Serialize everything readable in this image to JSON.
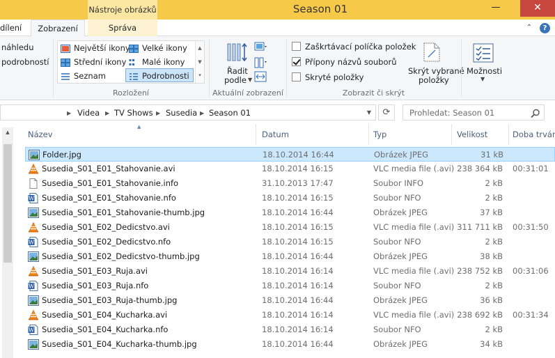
{
  "titlebar": {
    "context_tab": "Nástroje obrázků",
    "title": "Season 01",
    "minimize": "—",
    "maximize": "❐",
    "close": "✕"
  },
  "tabs": {
    "share": "dílení",
    "view": "Zobrazení",
    "manage": "Správa"
  },
  "ribbon": {
    "pane_items": [
      "náhledu",
      "podrobností"
    ],
    "layout": {
      "items": [
        "Největší ikony",
        "Velké ikony",
        "Střední ikony",
        "Malé ikony",
        "Seznam",
        "Podrobnosti"
      ],
      "selected": "Podrobnosti",
      "group_label": "Rozložení"
    },
    "current_view": {
      "sort_label_1": "Řadit",
      "sort_label_2": "podle",
      "group_label": "Aktuální zobrazení"
    },
    "show_hide": {
      "checkboxes": [
        {
          "label": "Zaškrtávací políčka položek",
          "checked": false
        },
        {
          "label": "Přípony názvů souborů",
          "checked": true
        },
        {
          "label": "Skryté položky",
          "checked": false
        }
      ],
      "hide_selected_1": "Skrýt vybrané",
      "hide_selected_2": "položky",
      "group_label": "Zobrazit či skrýt"
    },
    "options_label": "Možnosti"
  },
  "address": {
    "breadcrumbs": [
      "Videa",
      "TV Shows",
      "Susedia",
      "Season 01"
    ],
    "search_placeholder": "Prohledat: Season 01"
  },
  "columns": {
    "name": "Název",
    "date": "Datum",
    "type": "Typ",
    "size": "Velikost",
    "duration": "Doba trván"
  },
  "files": [
    {
      "name": "Folder.jpg",
      "date": "18.10.2014 16:44",
      "type": "Obrázek JPEG",
      "size": "31 kB",
      "duration": "",
      "icon": "jpg",
      "selected": true
    },
    {
      "name": "Susedia_S01_E01_Stahovanie.avi",
      "date": "18.10.2014 16:15",
      "type": "VLC media file (.avi)",
      "size": "238 364 kB",
      "duration": "00:31:01",
      "icon": "vlc",
      "selected": false
    },
    {
      "name": "Susedia_S01_E01_Stahovanie.info",
      "date": "31.10.2013 17:47",
      "type": "Soubor INFO",
      "size": "2 kB",
      "duration": "",
      "icon": "blank",
      "selected": false
    },
    {
      "name": "Susedia_S01_E01_Stahovanie.nfo",
      "date": "18.10.2014 16:15",
      "type": "Soubor NFO",
      "size": "2 kB",
      "duration": "",
      "icon": "nfo",
      "selected": false
    },
    {
      "name": "Susedia_S01_E01_Stahovanie-thumb.jpg",
      "date": "18.10.2014 16:44",
      "type": "Obrázek JPEG",
      "size": "37 kB",
      "duration": "",
      "icon": "jpg",
      "selected": false
    },
    {
      "name": "Susedia_S01_E02_Dedicstvo.avi",
      "date": "18.10.2014 16:15",
      "type": "VLC media file (.avi)",
      "size": "311 711 kB",
      "duration": "00:31:50",
      "icon": "vlc",
      "selected": false
    },
    {
      "name": "Susedia_S01_E02_Dedicstvo.nfo",
      "date": "18.10.2014 16:15",
      "type": "Soubor NFO",
      "size": "2 kB",
      "duration": "",
      "icon": "nfo",
      "selected": false
    },
    {
      "name": "Susedia_S01_E02_Dedicstvo-thumb.jpg",
      "date": "18.10.2014 16:44",
      "type": "Obrázek JPEG",
      "size": "38 kB",
      "duration": "",
      "icon": "jpg",
      "selected": false
    },
    {
      "name": "Susedia_S01_E03_Ruja.avi",
      "date": "18.10.2014 16:14",
      "type": "VLC media file (.avi)",
      "size": "238 752 kB",
      "duration": "00:31:06",
      "icon": "vlc",
      "selected": false
    },
    {
      "name": "Susedia_S01_E03_Ruja.nfo",
      "date": "18.10.2014 16:14",
      "type": "Soubor NFO",
      "size": "2 kB",
      "duration": "",
      "icon": "nfo",
      "selected": false
    },
    {
      "name": "Susedia_S01_E03_Ruja-thumb.jpg",
      "date": "18.10.2014 16:44",
      "type": "Obrázek JPEG",
      "size": "36 kB",
      "duration": "",
      "icon": "jpg",
      "selected": false
    },
    {
      "name": "Susedia_S01_E04_Kucharka.avi",
      "date": "18.10.2014 16:14",
      "type": "VLC media file (.avi)",
      "size": "238 692 kB",
      "duration": "00:31:34",
      "icon": "vlc",
      "selected": false
    },
    {
      "name": "Susedia_S01_E04_Kucharka.nfo",
      "date": "18.10.2014 16:14",
      "type": "Soubor NFO",
      "size": "2 kB",
      "duration": "",
      "icon": "nfo",
      "selected": false
    },
    {
      "name": "Susedia_S01_E04_Kucharka-thumb.jpg",
      "date": "18.10.2014 16:44",
      "type": "Obrázek JPEG",
      "size": "34 kB",
      "duration": "",
      "icon": "jpg",
      "selected": false
    }
  ]
}
